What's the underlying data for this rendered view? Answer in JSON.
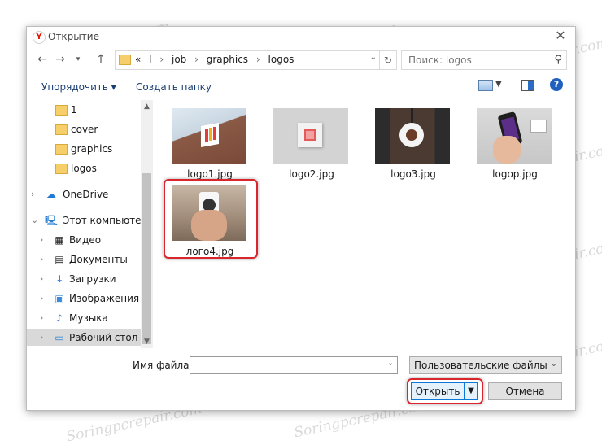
{
  "window": {
    "title": "Открытие",
    "app_icon_letter": "Y"
  },
  "navigation": {
    "breadcrumbs": [
      "«",
      "l",
      "job",
      "graphics",
      "logos"
    ],
    "search_placeholder": "Поиск: logos"
  },
  "toolbar": {
    "organize_label": "Упорядочить ▾",
    "new_folder_label": "Создать папку",
    "help_label": "?"
  },
  "tree": [
    {
      "label": "1",
      "icon": "folder-icon"
    },
    {
      "label": "cover",
      "icon": "folder-icon"
    },
    {
      "label": "graphics",
      "icon": "folder-icon"
    },
    {
      "label": "logos",
      "icon": "folder-icon"
    },
    {
      "label": "OneDrive",
      "icon": "cloud-icon"
    },
    {
      "label": "Этот компьютер",
      "icon": "computer-icon"
    },
    {
      "label": "Видео",
      "icon": "video-icon"
    },
    {
      "label": "Документы",
      "icon": "documents-icon"
    },
    {
      "label": "Загрузки",
      "icon": "download-icon"
    },
    {
      "label": "Изображения",
      "icon": "images-icon"
    },
    {
      "label": "Музыка",
      "icon": "music-icon"
    },
    {
      "label": "Рабочий стол",
      "icon": "desktop-icon",
      "selected": true
    }
  ],
  "files": [
    {
      "name": "logo1.jpg"
    },
    {
      "name": "logo2.jpg"
    },
    {
      "name": "logo3.jpg"
    },
    {
      "name": "logop.jpg"
    },
    {
      "name": "лого4.jpg",
      "highlighted": true
    }
  ],
  "footer": {
    "filename_label": "Имя файла:",
    "filename_value": "",
    "filetype_value": "Пользовательские файлы",
    "open_label": "Открыть",
    "cancel_label": "Отмена"
  },
  "colors": {
    "highlight": "#d8262c",
    "link": "#1a3e72",
    "accent": "#0b78d7"
  },
  "watermark": "Soringpcrepair.com"
}
